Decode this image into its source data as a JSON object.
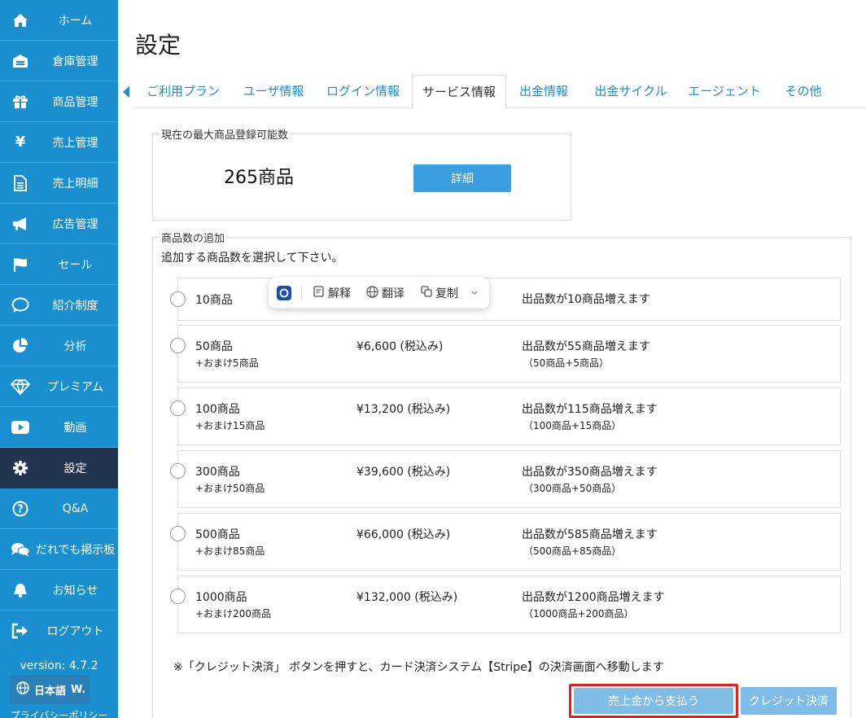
{
  "sidebar": {
    "items": [
      {
        "label": "ホーム",
        "icon": "home-icon"
      },
      {
        "label": "倉庫管理",
        "icon": "warehouse-icon"
      },
      {
        "label": "商品管理",
        "icon": "gift-icon"
      },
      {
        "label": "売上管理",
        "icon": "yen-icon"
      },
      {
        "label": "売上明細",
        "icon": "document-icon"
      },
      {
        "label": "広告管理",
        "icon": "megaphone-icon"
      },
      {
        "label": "セール",
        "icon": "flag-icon"
      },
      {
        "label": "紹介制度",
        "icon": "chat-bubble-icon"
      },
      {
        "label": "分析",
        "icon": "pie-chart-icon"
      },
      {
        "label": "プレミアム",
        "icon": "diamond-icon"
      },
      {
        "label": "動画",
        "icon": "video-icon"
      },
      {
        "label": "設定",
        "icon": "gear-icon",
        "active": true
      },
      {
        "label": "Q&A",
        "icon": "question-icon"
      },
      {
        "label": "だれでも掲示板",
        "icon": "comments-icon"
      },
      {
        "label": "お知らせ",
        "icon": "bell-icon"
      },
      {
        "label": "ログアウト",
        "icon": "logout-icon"
      }
    ],
    "version": "version: 4.7.2",
    "language": "日本語",
    "language_suffix": "W.",
    "privacy": "プライバシーポリシー"
  },
  "page": {
    "title": "設定"
  },
  "tabs": [
    {
      "label": "ご利用プラン"
    },
    {
      "label": "ユーザ情報"
    },
    {
      "label": "ログイン情報"
    },
    {
      "label": "サービス情報",
      "active": true
    },
    {
      "label": "出金情報"
    },
    {
      "label": "出金サイクル"
    },
    {
      "label": "エージェント"
    },
    {
      "label": "その他"
    }
  ],
  "max_section": {
    "legend": "現在の最大商品登録可能数",
    "value": "265商品",
    "detail_button": "詳細"
  },
  "add_section": {
    "legend": "商品数の追加",
    "instruction": "追加する商品数を選択して下さい。",
    "options": [
      {
        "name": "10商品",
        "bonus": "",
        "price": "",
        "result": "出品数が10商品増えます",
        "detail": ""
      },
      {
        "name": "50商品",
        "bonus": "+おまけ5商品",
        "price": "¥6,600 (税込み)",
        "result": "出品数が55商品増えます",
        "detail": "（50商品+5商品）"
      },
      {
        "name": "100商品",
        "bonus": "+おまけ15商品",
        "price": "¥13,200 (税込み)",
        "result": "出品数が115商品増えます",
        "detail": "（100商品+15商品）"
      },
      {
        "name": "300商品",
        "bonus": "+おまけ50商品",
        "price": "¥39,600 (税込み)",
        "result": "出品数が350商品増えます",
        "detail": "（300商品+50商品）"
      },
      {
        "name": "500商品",
        "bonus": "+おまけ85商品",
        "price": "¥66,000 (税込み)",
        "result": "出品数が585商品増えます",
        "detail": "（500商品+85商品）"
      },
      {
        "name": "1000商品",
        "bonus": "+おまけ200商品",
        "price": "¥132,000 (税込み)",
        "result": "出品数が1200商品増えます",
        "detail": "（1000商品+200商品）"
      }
    ],
    "note": "※「クレジット決済」 ボタンを押すと、カード決済システム【Stripe】の決済画面へ移動します",
    "pay_from_sales_button": "売上金から支払う",
    "credit_button": "クレジット決済"
  },
  "float_toolbar": {
    "explain": "解释",
    "translate": "翻译",
    "copy": "复制"
  },
  "colors": {
    "sidebar_bg": "#1a8fd0",
    "sidebar_active": "#23344f",
    "accent": "#3a9fe0",
    "highlight_border": "#e0201a"
  }
}
